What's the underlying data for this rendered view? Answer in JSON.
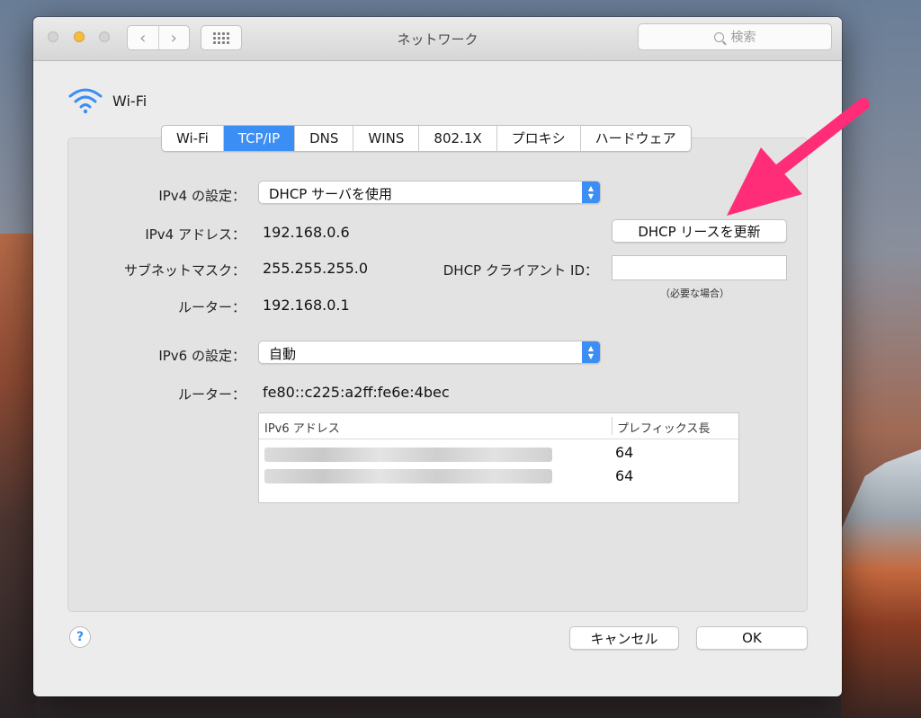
{
  "window": {
    "title": "ネットワーク",
    "search_placeholder": "検索"
  },
  "header": {
    "service_name": "Wi-Fi"
  },
  "tabs": [
    {
      "label": "Wi-Fi"
    },
    {
      "label": "TCP/IP"
    },
    {
      "label": "DNS"
    },
    {
      "label": "WINS"
    },
    {
      "label": "802.1X"
    },
    {
      "label": "プロキシ"
    },
    {
      "label": "ハードウェア"
    }
  ],
  "active_tab": "TCP/IP",
  "ipv4": {
    "config_label": "IPv4 の設定：",
    "config_value": "DHCP サーバを使用",
    "address_label": "IPv4 アドレス：",
    "address_value": "192.168.0.6",
    "subnet_label": "サブネットマスク：",
    "subnet_value": "255.255.255.0",
    "router_label": "ルーター：",
    "router_value": "192.168.0.1"
  },
  "dhcp": {
    "renew_button": "DHCP リースを更新",
    "client_id_label": "DHCP クライアント ID：",
    "client_id_value": "",
    "client_id_hint": "（必要な場合）"
  },
  "ipv6": {
    "config_label": "IPv6 の設定：",
    "config_value": "自動",
    "router_label": "ルーター：",
    "router_value": "fe80::c225:a2ff:fe6e:4bec",
    "table": {
      "columns": [
        "IPv6 アドレス",
        "プレフィックス長"
      ],
      "rows": [
        {
          "address": "",
          "prefix": "64"
        },
        {
          "address": "",
          "prefix": "64"
        }
      ]
    }
  },
  "footer": {
    "help": "?",
    "cancel_button": "キャンセル",
    "ok_button": "OK"
  },
  "colors": {
    "accent": "#3b8ef3",
    "annotation_arrow": "#ff2d78"
  }
}
